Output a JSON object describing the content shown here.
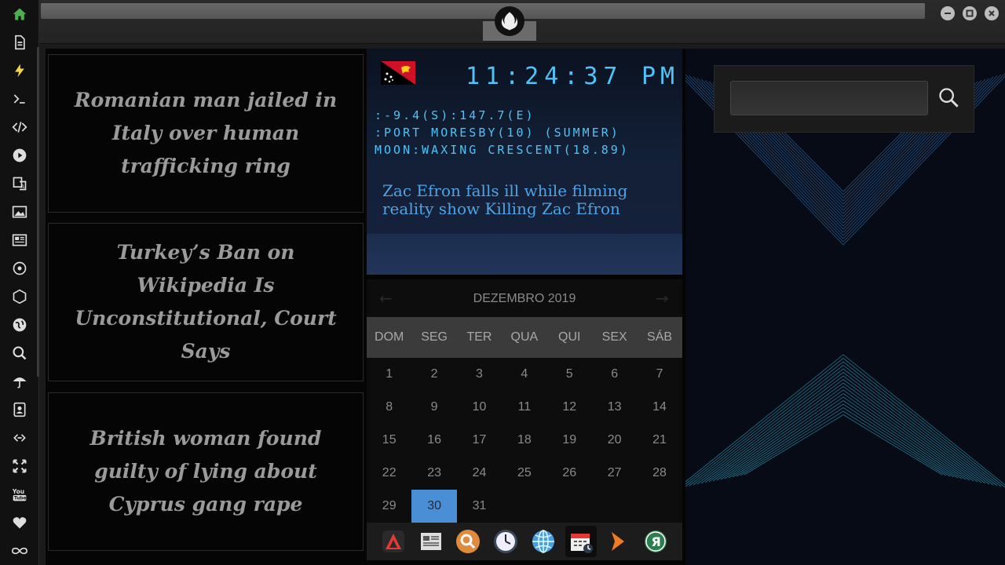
{
  "rail": {
    "icons": [
      "home-icon",
      "document-icon",
      "lightning-icon",
      "terminal-icon",
      "code-icon",
      "play-icon",
      "translate-icon",
      "image-icon",
      "news-icon",
      "rebel-icon",
      "empire-icon",
      "globe-icon",
      "search-icon",
      "umbrella-icon",
      "contacts-icon",
      "link-icon",
      "expand-icon",
      "youtube-icon",
      "heart-icon",
      "infinity-icon"
    ],
    "active_color": "#4caf50"
  },
  "news": [
    {
      "headline": "Romanian man jailed in Italy over human trafficking ring"
    },
    {
      "headline": "Turkey’s Ban on Wikipedia Is Unconstitutional, Court Says"
    },
    {
      "headline": "British woman found guilty of lying about Cyprus gang rape"
    }
  ],
  "clock": {
    "time": "11:24:37",
    "ampm": "PM",
    "coords": ":-9.4(S):147.7(E)",
    "location": ":PORT MORESBY(10) (SUMMER)",
    "moon": "MOON:WAXING CRESCENT(18.89)",
    "headline": "Zac Efron falls ill while filming reality show Killing Zac Efron",
    "accent": "#4fc3f7"
  },
  "calendar": {
    "month": "DEZEMBRO 2019",
    "weekdays": [
      "DOM",
      "SEG",
      "TER",
      "QUA",
      "QUI",
      "SEX",
      "SÁB"
    ],
    "weeks": [
      [
        "1",
        "2",
        "3",
        "4",
        "5",
        "6",
        "7"
      ],
      [
        "8",
        "9",
        "10",
        "11",
        "12",
        "13",
        "14"
      ],
      [
        "15",
        "16",
        "17",
        "18",
        "19",
        "20",
        "21"
      ],
      [
        "22",
        "23",
        "24",
        "25",
        "26",
        "27",
        "28"
      ],
      [
        "29",
        "30",
        "31",
        "",
        "",
        "",
        ""
      ]
    ],
    "selected": "30",
    "selected_color": "#4a8fd6"
  },
  "dock": {
    "items": [
      "red-app-icon",
      "newspaper-icon",
      "search-app-icon",
      "clock-app-icon",
      "globe-app-icon",
      "calendar-app-icon",
      "arrow-app-icon",
      "yandex-app-icon"
    ],
    "active": "calendar-app-icon"
  },
  "search": {
    "value": "",
    "placeholder": ""
  }
}
